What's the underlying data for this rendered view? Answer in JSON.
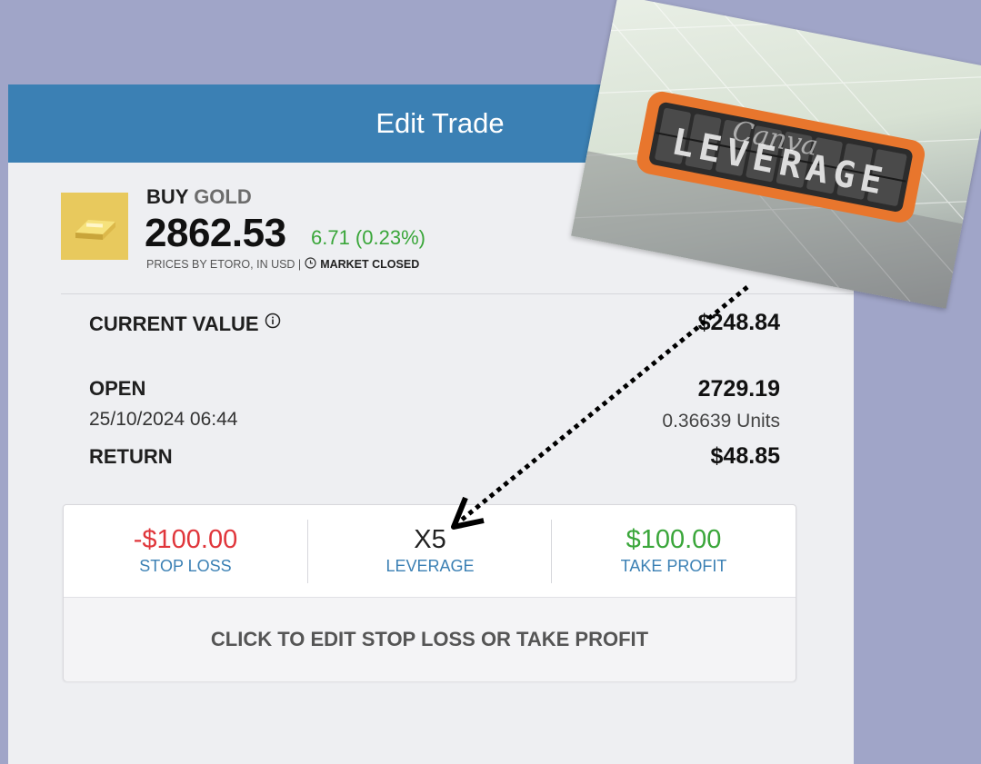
{
  "header": {
    "title": "Edit Trade"
  },
  "asset": {
    "action": "BUY",
    "symbol": "GOLD",
    "price": "2862.53",
    "change": "6.71 (0.23%)",
    "source": "PRICES BY ETORO, IN USD |",
    "market_status": "MARKET CLOSED",
    "icon": "gold-bar-icon"
  },
  "position": {
    "current_value_label": "CURRENT VALUE",
    "current_value": "$248.84",
    "open_label": "OPEN",
    "open_date": "25/10/2024 06:44",
    "open_price": "2729.19",
    "units": "0.36639 Units",
    "return_label": "RETURN",
    "return_value": "$48.85"
  },
  "controls": {
    "stop_loss_value": "-$100.00",
    "stop_loss_label": "STOP LOSS",
    "leverage_value": "X5",
    "leverage_label": "LEVERAGE",
    "take_profit_value": "$100.00",
    "take_profit_label": "TAKE PROFIT",
    "edit_label": "CLICK TO EDIT STOP LOSS OR TAKE PROFIT"
  },
  "overlay": {
    "image_text": "LEVERAGE",
    "watermark": "Canva"
  },
  "colors": {
    "background": "#a0a5c8",
    "header": "#3b80b4",
    "negative": "#e0363b",
    "positive": "#3aa63a",
    "link": "#3b80b4"
  }
}
